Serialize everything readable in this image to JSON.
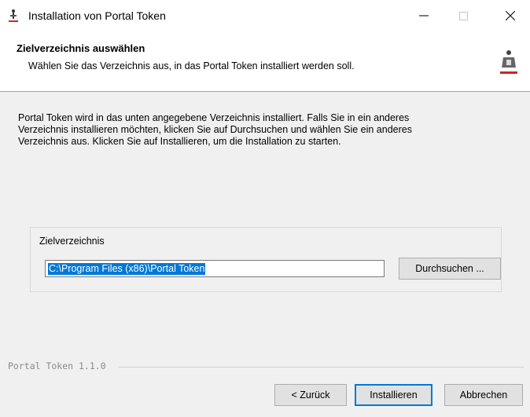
{
  "window": {
    "title": "Installation von Portal Token",
    "minimize_glyph": "—",
    "close_glyph": "✕"
  },
  "header": {
    "title": "Zielverzeichnis auswählen",
    "subtitle": "Wählen Sie das Verzeichnis aus, in das Portal Token installiert werden soll."
  },
  "body": {
    "description_line1": "Portal Token wird in das unten angegebene Verzeichnis installiert. Falls Sie in ein anderes",
    "description_line2": "Verzeichnis installieren möchten, klicken Sie auf Durchsuchen und wählen Sie ein anderes",
    "description_line3": "Verzeichnis aus. Klicken Sie auf Installieren, um die Installation zu starten."
  },
  "destination": {
    "group_label": "Zielverzeichnis",
    "path_value": "C:\\Program Files (x86)\\Portal Token",
    "browse_label": "Durchsuchen ..."
  },
  "footer": {
    "version": "Portal Token 1.1.0",
    "back_label": "< Zurück",
    "install_label": "Installieren",
    "cancel_label": "Abbrechen"
  },
  "colors": {
    "selection": "#0078d7",
    "focus_border": "#0078d7"
  }
}
